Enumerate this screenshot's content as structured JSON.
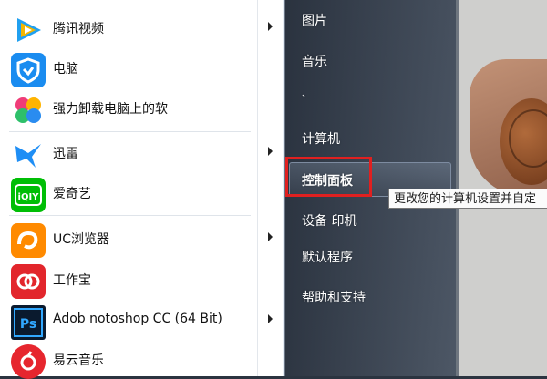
{
  "programs": [
    {
      "label": "腾讯视频",
      "icon": "tencent-video-icon",
      "has_arrow": true
    },
    {
      "label": "电脑",
      "icon": "pc-manager-shield-icon",
      "has_arrow": false
    },
    {
      "label": "强力卸载电脑上的软",
      "icon": "uninstall-leaf-icon",
      "has_arrow": false
    },
    {
      "label": "迅雷",
      "icon": "thunder-bird-icon",
      "has_arrow": true
    },
    {
      "label": "爱奇艺",
      "icon": "iqiyi-icon",
      "has_arrow": false
    },
    {
      "label": "UC浏览器",
      "icon": "uc-browser-icon",
      "has_arrow": true
    },
    {
      "label": "工作宝",
      "icon": "gongzuobao-icon",
      "has_arrow": false
    },
    {
      "label": "Adob  notoshop CC (64 Bit)",
      "icon": "photoshop-icon",
      "has_arrow": true
    },
    {
      "label": "易云音乐",
      "icon": "netease-music-icon",
      "has_arrow": false
    }
  ],
  "right_links": [
    {
      "label": "图片"
    },
    {
      "label": "音乐"
    },
    {
      "label": "计算机"
    },
    {
      "label": "控制面板"
    },
    {
      "label": "设备  印机"
    },
    {
      "label": "默认程序"
    },
    {
      "label": "帮助和支持"
    }
  ],
  "tooltip": "更改您的计算机设置并自定",
  "colors": {
    "highlight": "#e02020",
    "panel": "#3d4756"
  }
}
